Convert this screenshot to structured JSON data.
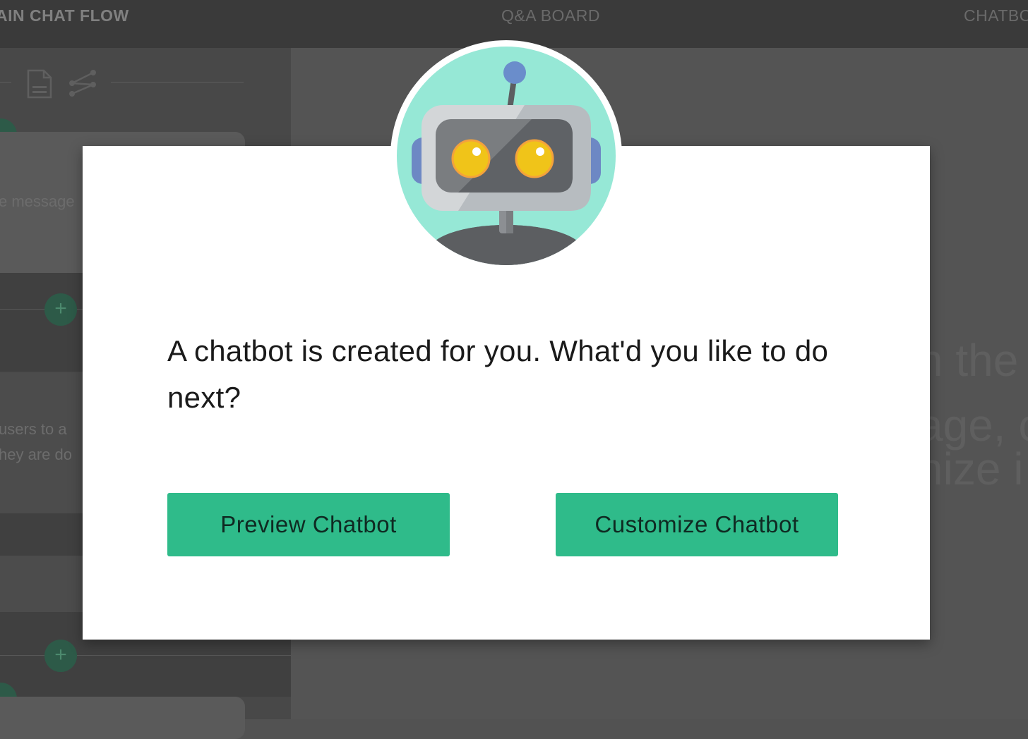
{
  "tabs": [
    {
      "label": "AIN CHAT FLOW",
      "active": true
    },
    {
      "label": "Q&A BOARD",
      "active": false
    },
    {
      "label": "CHATBO",
      "active": false
    }
  ],
  "sidebar": {
    "msg_text_1": "e message",
    "msg_text_2": "users to a",
    "msg_text_3": "hey are do",
    "add_symbol": "+"
  },
  "main": {
    "bg_line_1": "n the",
    "bg_line_2": "age, c",
    "bg_line_3": "nize i"
  },
  "modal": {
    "message": "A chatbot is created for you. What'd you like to do next?",
    "preview_label": "Preview Chatbot",
    "customize_label": "Customize Chatbot"
  },
  "icons": [
    "document-icon",
    "share-icon",
    "robot-avatar"
  ],
  "colors": {
    "accent": "#2fbb8a",
    "avatar_bg": "#96e8d6",
    "overlay": "#525252"
  }
}
